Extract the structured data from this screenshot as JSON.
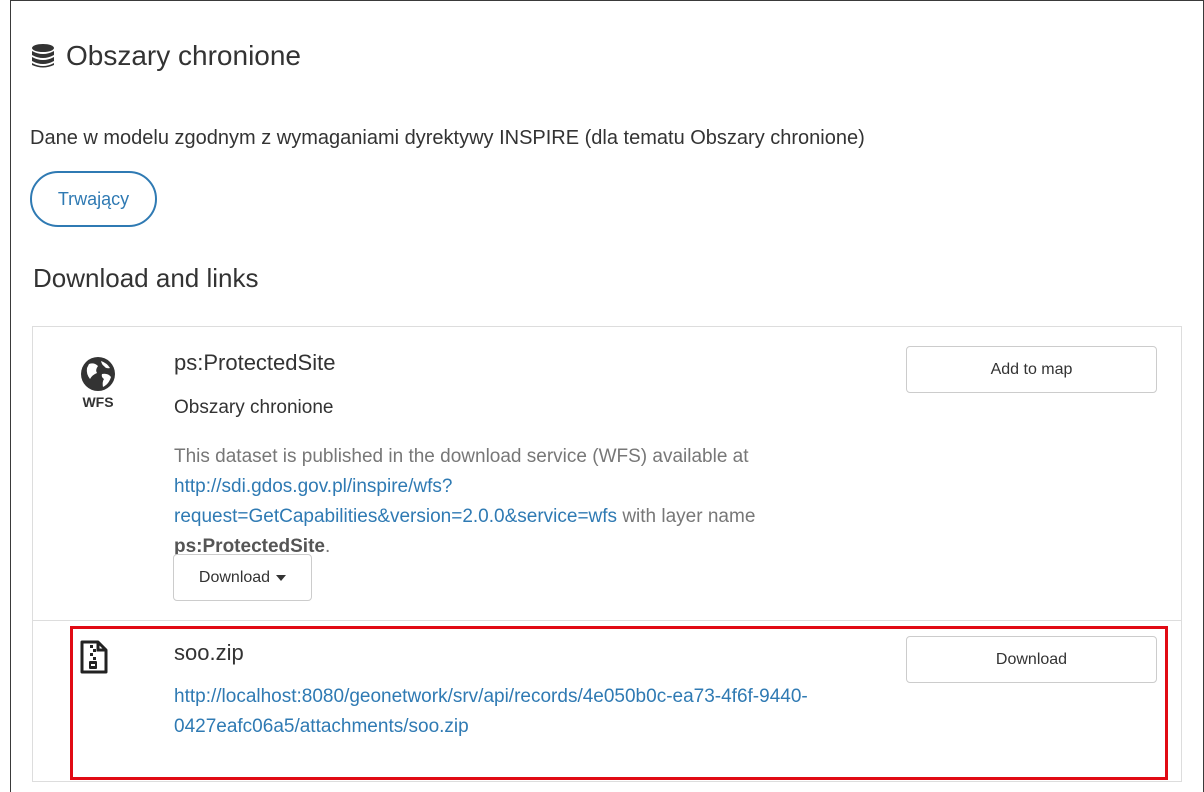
{
  "header": {
    "title": "Obszary chronione",
    "icon": "database-icon"
  },
  "description": "Dane w modelu zgodnym z wymaganiami dyrektywy INSPIRE (dla tematu Obszary chronione)",
  "status_badge": "Trwający",
  "section_title": "Download and links",
  "resources": [
    {
      "icon": "globe-icon",
      "protocol": "WFS",
      "title": "ps:ProtectedSite",
      "subtitle": "Obszary chronione",
      "description_prefix": "This dataset is published in the download service (WFS) available at ",
      "link": "http://sdi.gdos.gov.pl/inspire/wfs?request=GetCapabilities&version=2.0.0&service=wfs",
      "description_middle": " with layer name ",
      "layer_name": "ps:ProtectedSite",
      "description_suffix": ".",
      "action_button": "Add to map",
      "dropdown_button": "Download"
    },
    {
      "icon": "file-zip-icon",
      "title": "soo.zip",
      "link": "http://localhost:8080/geonetwork/srv/api/records/4e050b0c-ea73-4f6f-9440-0427eafc06a5/attachments/soo.zip",
      "action_button": "Download"
    }
  ],
  "colors": {
    "link": "#2f7ab3",
    "highlight": "#e10a14",
    "muted_text": "#777777"
  }
}
